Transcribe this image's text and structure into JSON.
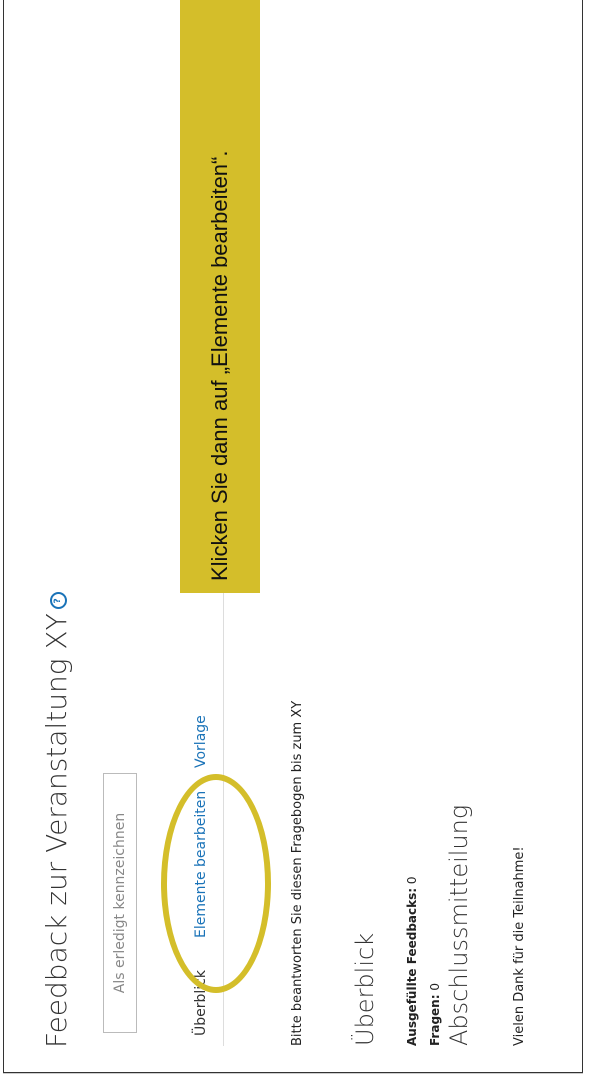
{
  "page": {
    "title": "Feedback zur Veranstaltung XY",
    "info_icon_glyph": "?"
  },
  "actions": {
    "mark_done": "Als erledigt kennzeichnen"
  },
  "tabs": [
    {
      "label": "Überblick",
      "active": true
    },
    {
      "label": "Elemente bearbeiten",
      "active": false
    },
    {
      "label": "Vorlage",
      "active": false
    }
  ],
  "content": {
    "intro": "Bitte beantworten Sie diesen Fragebogen bis zum XY",
    "overview_heading": "Überblick",
    "stats": [
      {
        "label": "Ausgefüllte Feedbacks:",
        "value": "0"
      },
      {
        "label": "Fragen:",
        "value": "0"
      }
    ],
    "final_heading": "Abschlussmitteilung",
    "thanks": "Vielen Dank für die Teilnahme!"
  },
  "annotation": {
    "text": "Klicken Sie dann auf „Elemente bearbeiten“.",
    "color": "#d4be2a"
  },
  "colors": {
    "link": "#1a73b8",
    "highlight": "#d4be2a"
  }
}
